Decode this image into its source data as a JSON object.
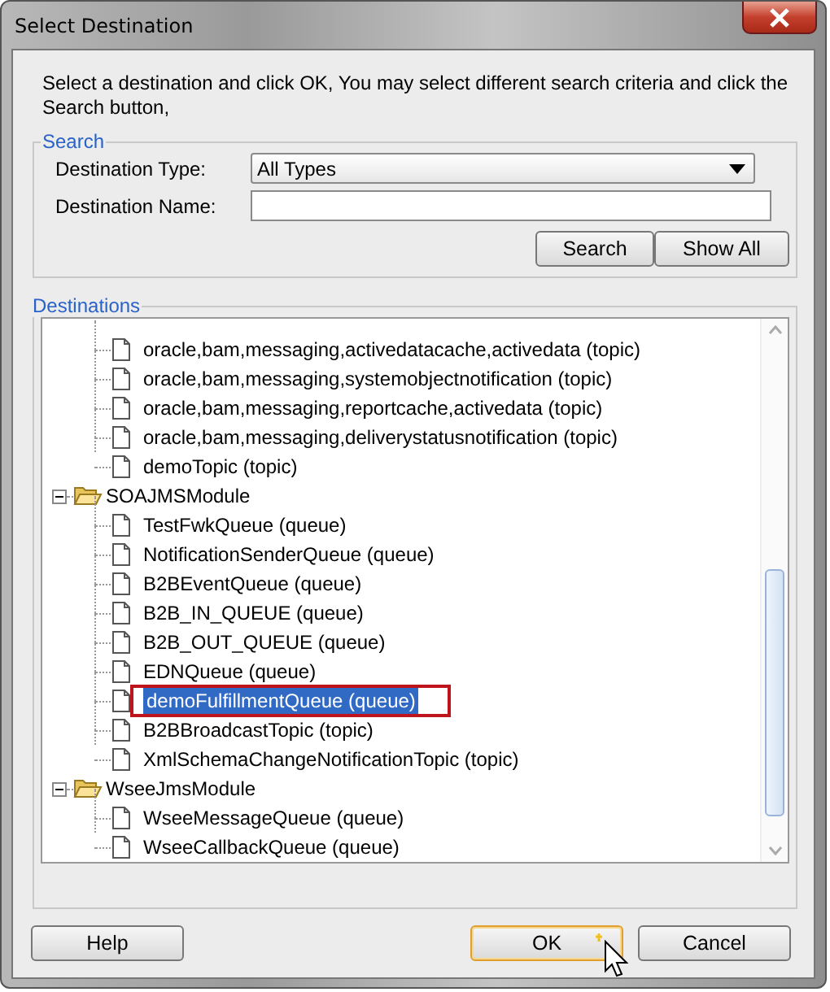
{
  "window": {
    "title": "Select Destination"
  },
  "instructions": "Select a destination and click OK, You may select different search criteria and click the Search button,",
  "search": {
    "legend": "Search",
    "type_label": "Destination Type:",
    "type_value": "All Types",
    "name_label": "Destination Name:",
    "buttons": [
      "Search",
      "Show All"
    ]
  },
  "destinations": {
    "legend": "Destinations",
    "tree": [
      {
        "kind": "continued",
        "children": [
          {
            "label": "oracle,bam,messaging,activedatacache,activedata (topic)",
            "selected": false,
            "callout": false
          },
          {
            "label": "oracle,bam,messaging,systemobjectnotification (topic)",
            "selected": false,
            "callout": false
          },
          {
            "label": "oracle,bam,messaging,reportcache,activedata (topic)",
            "selected": false,
            "callout": false
          },
          {
            "label": "oracle,bam,messaging,deliverystatusnotification (topic)",
            "selected": false,
            "callout": false
          },
          {
            "label": "demoTopic (topic)",
            "selected": false,
            "callout": false
          }
        ]
      },
      {
        "kind": "folder",
        "label": "SOAJMSModule",
        "expanded": true,
        "children": [
          {
            "label": "TestFwkQueue (queue)",
            "selected": false,
            "callout": false
          },
          {
            "label": "NotificationSenderQueue (queue)",
            "selected": false,
            "callout": false
          },
          {
            "label": "B2BEventQueue (queue)",
            "selected": false,
            "callout": false
          },
          {
            "label": "B2B_IN_QUEUE (queue)",
            "selected": false,
            "callout": false
          },
          {
            "label": "B2B_OUT_QUEUE (queue)",
            "selected": false,
            "callout": false
          },
          {
            "label": "EDNQueue (queue)",
            "selected": false,
            "callout": false
          },
          {
            "label": "demoFulfillmentQueue (queue)",
            "selected": true,
            "callout": true
          },
          {
            "label": "B2BBroadcastTopic (topic)",
            "selected": false,
            "callout": false
          },
          {
            "label": "XmlSchemaChangeNotificationTopic (topic)",
            "selected": false,
            "callout": false
          }
        ]
      },
      {
        "kind": "folder",
        "label": "WseeJmsModule",
        "expanded": true,
        "children": [
          {
            "label": "WseeMessageQueue (queue)",
            "selected": false,
            "callout": false
          },
          {
            "label": "WseeCallbackQueue (queue)",
            "selected": false,
            "callout": false
          }
        ]
      }
    ]
  },
  "footer": {
    "buttons": [
      {
        "label": "Help",
        "kind": "left"
      },
      {
        "label": "OK",
        "kind": "default"
      },
      {
        "label": "Cancel",
        "kind": "normal"
      }
    ]
  }
}
